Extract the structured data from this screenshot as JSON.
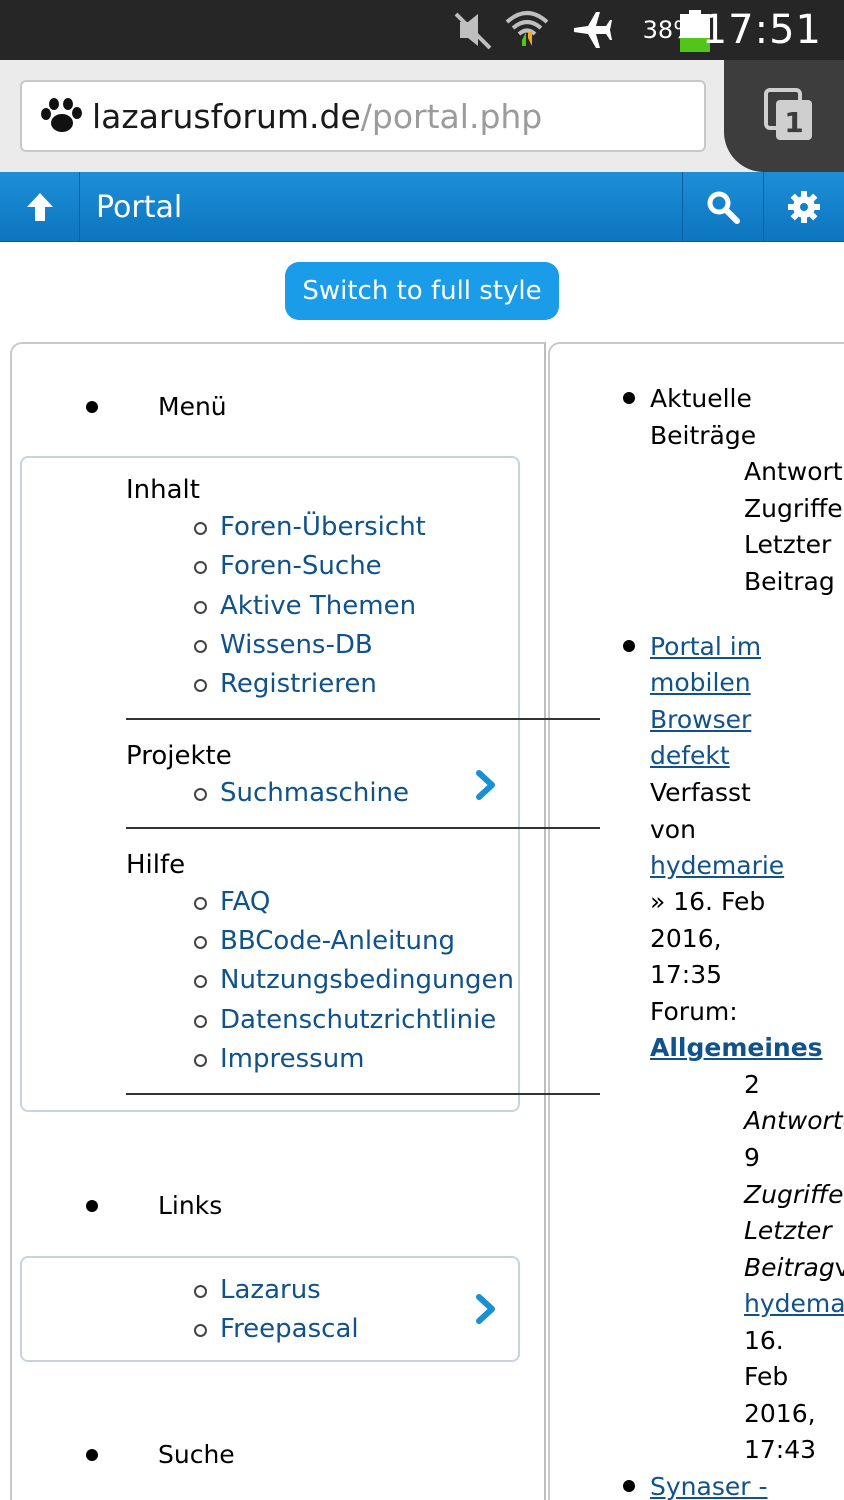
{
  "status_bar": {
    "battery_percent": "38%",
    "battery_level": 0.38,
    "time": "17:51",
    "icons": [
      "mute-icon",
      "wifi-icon",
      "airplane-mode-icon"
    ]
  },
  "browser": {
    "url_host": "lazarusforum.de",
    "url_path": "/portal.php",
    "tab_count": "1"
  },
  "header": {
    "title": "Portal"
  },
  "switch_button": "Switch to full style",
  "left_column": {
    "menu_heading": "Menü",
    "groups": [
      {
        "label": "Inhalt",
        "links": [
          "Foren-Übersicht",
          "Foren-Suche",
          "Aktive Themen",
          "Wissens-DB",
          "Registrieren"
        ]
      },
      {
        "label": "Projekte",
        "links": [
          "Suchmaschine"
        ]
      },
      {
        "label": "Hilfe",
        "links": [
          "FAQ",
          "BBCode-Anleitung",
          "Nutzungsbedingungen",
          "Datenschutzrichtlinie",
          "Impressum"
        ]
      }
    ],
    "links_heading": "Links",
    "links_items": [
      "Lazarus",
      "Freepascal"
    ],
    "search_heading": "Suche"
  },
  "right_column": {
    "heading_line1": "Aktuelle",
    "heading_line2": "Beiträge",
    "col_labels": [
      "Antworten",
      "Zugriffe",
      "Letzter",
      "Beitrag"
    ],
    "post1": {
      "title_lines": [
        "Portal im",
        "mobilen",
        "Browser",
        "defekt"
      ],
      "by_line1": "Verfasst",
      "by_line2": "von",
      "author": "hydemarie",
      "date_lines": [
        "» 16. Feb",
        "2016,",
        "17:35"
      ],
      "forum_label": "Forum:",
      "forum": "Allgemeines",
      "replies": "2",
      "replies_label": "Antworten",
      "views": "9",
      "views_label": "Zugriffe",
      "last_label1": "Letzter",
      "last_label2": "Beitrag",
      "last_by": "von",
      "last_author": "hydemarie",
      "last_date_lines": [
        "16.",
        "Feb",
        "2016,",
        "17:43"
      ]
    },
    "post2_title": "Synaser -"
  }
}
